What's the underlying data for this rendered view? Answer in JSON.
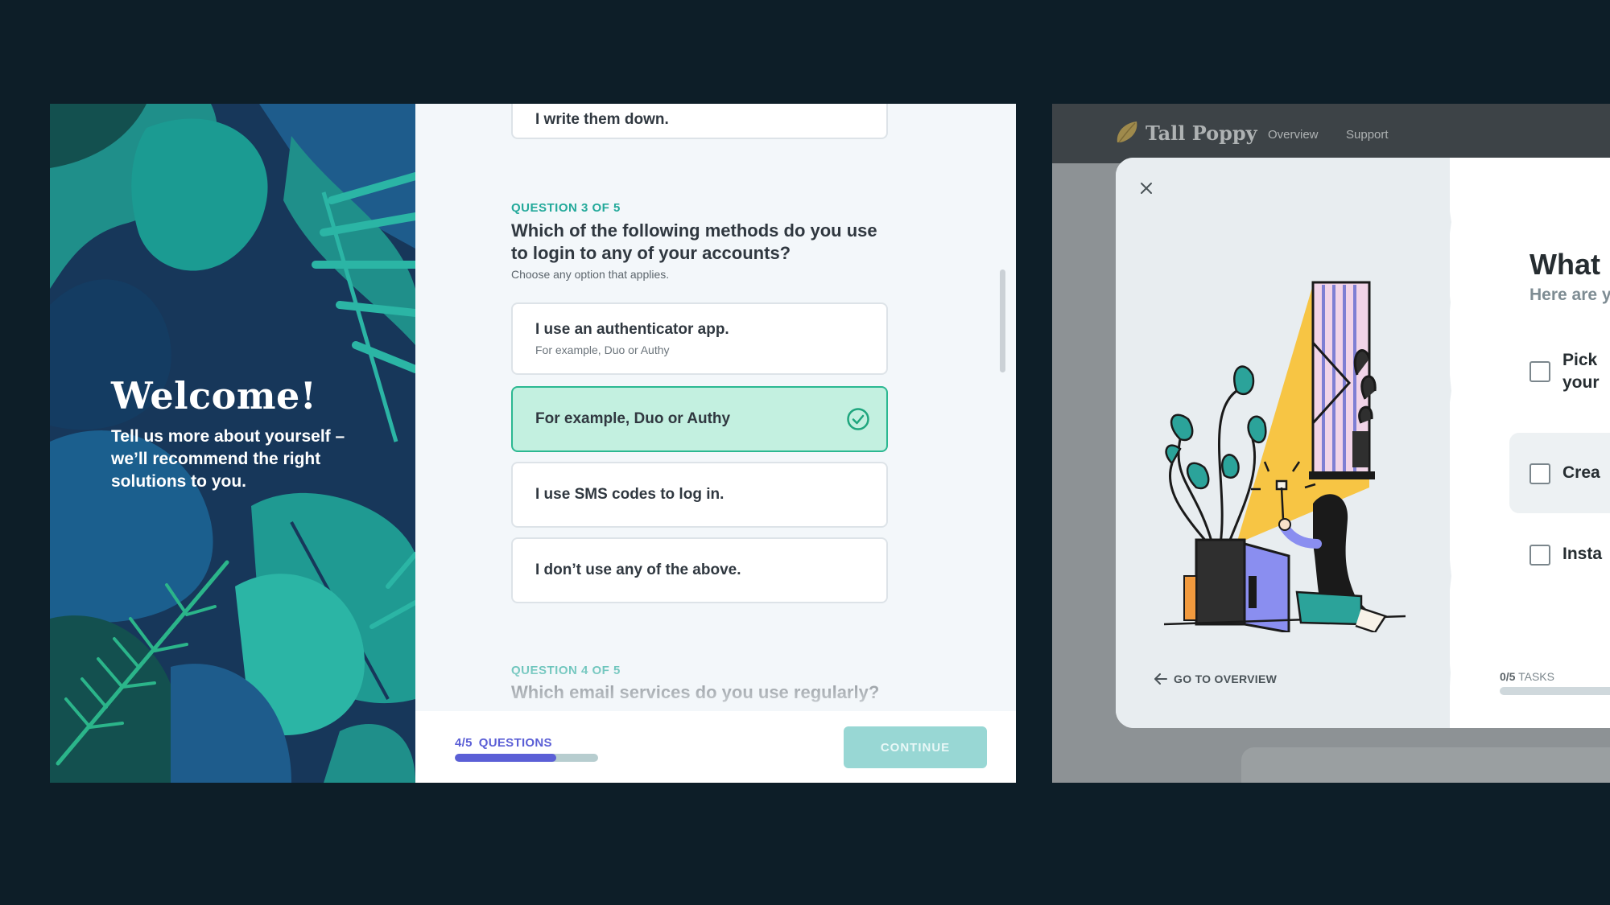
{
  "survey": {
    "welcome_title": "Welcome!",
    "welcome_subtitle": "Tell us more about yourself – we’ll recommend the right solutions to you.",
    "prev_option": "I write them down.",
    "q3": {
      "kicker": "QUESTION 3 OF 5",
      "title": "Which of the following methods do you use to login to any of your accounts?",
      "help": "Choose any option that applies.",
      "options": [
        {
          "label": "I use an authenticator app.",
          "hint": "For example, Duo or Authy",
          "selected": false
        },
        {
          "label": "For example, Duo or Authy",
          "hint": "",
          "selected": true
        },
        {
          "label": "I use SMS codes to log in.",
          "hint": "",
          "selected": false
        },
        {
          "label": "I don’t use any of the above.",
          "hint": "",
          "selected": false
        }
      ]
    },
    "q4": {
      "kicker": "QUESTION 4 OF 5",
      "title": "Which email services do you use regularly?"
    },
    "footer": {
      "progress_count": "4/5",
      "progress_word": "QUESTIONS",
      "progress_fraction": 0.71,
      "continue_label": "CONTINUE"
    },
    "colors": {
      "accent": "#5b5fd6",
      "teal": "#23a99a",
      "selected_bg": "#c3f0e0",
      "selected_border": "#2bb891"
    }
  },
  "app": {
    "brand": "Tall Poppy",
    "nav": [
      "Overview",
      "Support"
    ],
    "modal": {
      "title": "What",
      "subtitle": "Here are y passwor",
      "tasks": [
        "Pick your",
        "Crea",
        "Insta"
      ],
      "go_overview": "GO TO OVERVIEW",
      "tasks_count": "0/5",
      "tasks_word": "TASKS",
      "tasks_fraction": 0
    }
  }
}
